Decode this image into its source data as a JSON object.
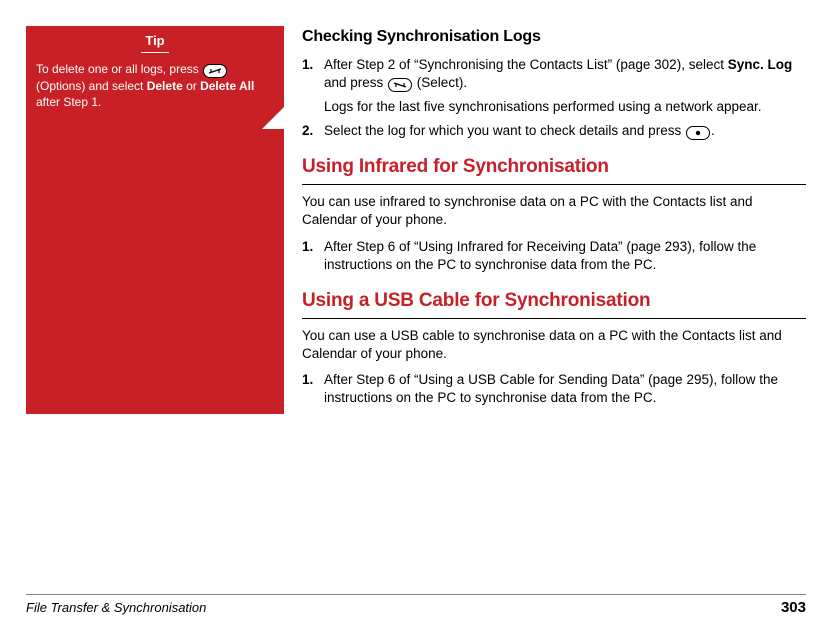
{
  "tip": {
    "title": "Tip",
    "line1_a": "To delete one or all logs, press ",
    "line1_b": " (Options) and select ",
    "bold_delete": "Delete",
    "line1_c": " or ",
    "bold_delete_all": "Delete All",
    "line1_d": " after Step 1."
  },
  "sections": {
    "checking": {
      "heading": "Checking Synchronisation Logs",
      "step1_num": "1.",
      "step1_a": "After Step 2 of “Synchronising the Contacts List” (page 302), select ",
      "step1_bold": "Sync. Log",
      "step1_b": " and press ",
      "step1_c": " (Select).",
      "step1_sub": "Logs for the last five synchronisations performed using a network appear.",
      "step2_num": "2.",
      "step2_a": "Select the log for which you want to check details and press ",
      "step2_b": "."
    },
    "infrared": {
      "heading": "Using Infrared for Synchronisation",
      "para": "You can use infrared to synchronise data on a PC with the Contacts list and Calendar of your phone.",
      "step1_num": "1.",
      "step1": "After Step 6 of “Using Infrared for Receiving Data” (page 293), follow the instructions on the PC to synchronise data from the PC."
    },
    "usb": {
      "heading": "Using a USB Cable for Synchronisation",
      "para": "You can use a USB cable to synchronise data on a PC with the Contacts list and Calendar of your phone.",
      "step1_num": "1.",
      "step1": "After Step 6 of “Using a USB Cable for Sending Data” (page 295), follow the instructions on the PC to synchronise data from the PC."
    }
  },
  "footer": {
    "section": "File Transfer & Synchronisation",
    "page": "303"
  }
}
